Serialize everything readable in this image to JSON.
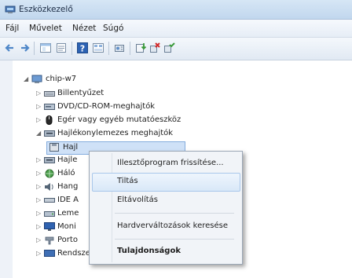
{
  "window": {
    "title": "Eszközkezelő",
    "icon": "device-manager-icon"
  },
  "menu": [
    "Fájl",
    "Művelet",
    "Nézet",
    "Súgó"
  ],
  "toolbar": {
    "buttons": [
      "back-arrow-icon",
      "forward-arrow-icon",
      "show-hide-icon",
      "properties-icon",
      "help-icon",
      "view-icon",
      "scan-hardware-icon",
      "update-driver-icon",
      "uninstall-icon",
      "enable-device-icon"
    ]
  },
  "tree": {
    "root": "chip-w7",
    "items": [
      {
        "label": "Billentyűzet",
        "icon": "keyboard-icon",
        "expanded": false
      },
      {
        "label": "DVD/CD-ROM-meghajtók",
        "icon": "dvd-drive-icon",
        "expanded": false
      },
      {
        "label": "Egér vagy egyéb mutatóeszköz",
        "icon": "mouse-icon",
        "expanded": false
      },
      {
        "label": "Hajlékonylemezes meghajtók",
        "icon": "floppy-drive-icon",
        "expanded": true
      },
      {
        "label": "Hajl",
        "icon": "floppy-icon",
        "selected": true
      },
      {
        "label": "Hajle",
        "icon": "floppy-controller-icon",
        "expanded": false
      },
      {
        "label": "Háló",
        "icon": "network-icon",
        "expanded": false
      },
      {
        "label": "Hang",
        "icon": "sound-icon",
        "expanded": false
      },
      {
        "label": "IDE A",
        "icon": "ide-controller-icon",
        "expanded": false
      },
      {
        "label": "Leme",
        "icon": "disk-icon",
        "expanded": false
      },
      {
        "label": "Moni",
        "icon": "monitor-icon",
        "expanded": false
      },
      {
        "label": "Porto",
        "icon": "port-icon",
        "expanded": false
      },
      {
        "label": "Rendszereszközök",
        "icon": "system-devices-icon",
        "expanded": false
      }
    ]
  },
  "context_menu": {
    "items": [
      "Illesztőprogram frissítése...",
      "Tiltás",
      "Eltávolítás",
      "Hardverváltozások keresése",
      "Tulajdonságok"
    ],
    "highlighted": "Tiltás"
  },
  "colors": {
    "accent": "#3f6fb5",
    "highlight": "#d9e8f8"
  }
}
